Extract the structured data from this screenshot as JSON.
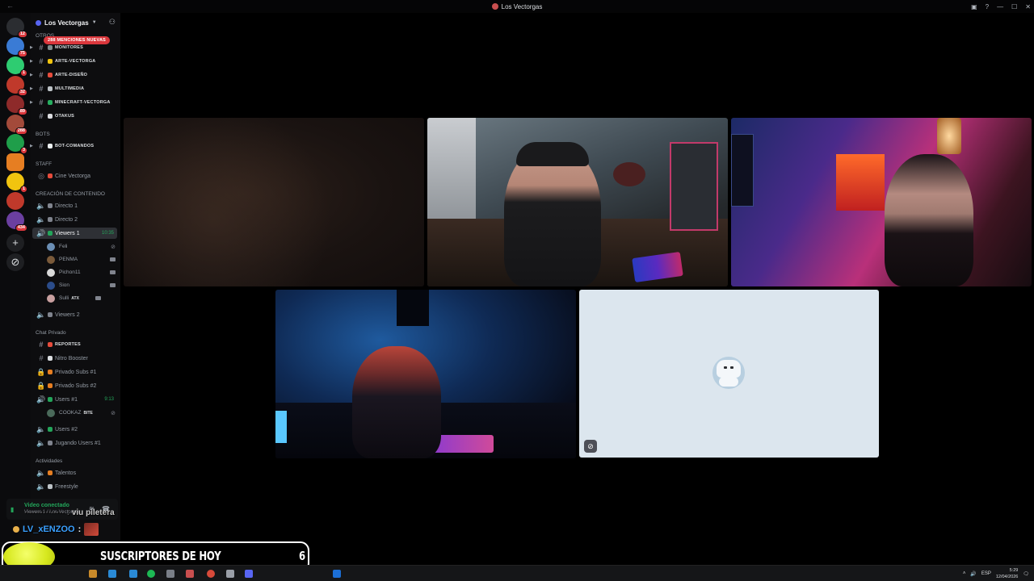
{
  "window": {
    "title": "Los Vectorgas",
    "controls": [
      "inbox-icon",
      "help-icon",
      "minimize-icon",
      "maximize-icon",
      "close-icon"
    ]
  },
  "rail": {
    "servers": [
      {
        "name": "direct-messages",
        "badge": "12",
        "color": "#2b2d31"
      },
      {
        "name": "server-1",
        "badge": "75",
        "color": "#3a7bd5"
      },
      {
        "name": "server-2",
        "badge": "1",
        "color": "#2ecc71"
      },
      {
        "name": "server-3",
        "badge": "32",
        "color": "#c0392b"
      },
      {
        "name": "server-4",
        "badge": "89",
        "color": "#8e2a2a"
      },
      {
        "name": "los-vectorgas",
        "badge": "288",
        "color": "#a34a3a"
      },
      {
        "name": "server-6",
        "badge": "3",
        "color": "#1f9e4a"
      },
      {
        "name": "server-7",
        "badge": "",
        "color": "#e67e22"
      },
      {
        "name": "server-8",
        "badge": "1",
        "color": "#f1c40f"
      },
      {
        "name": "server-9",
        "badge": "",
        "color": "#c0392b"
      },
      {
        "name": "server-10",
        "badge": "434",
        "color": "#6b3fa0"
      }
    ]
  },
  "sidebar": {
    "server_name": "Los Vectorgas",
    "mentions_pill": "288 MENCIONES NUEVAS",
    "categories": {
      "otros": "OTROS",
      "bots": "BOTS",
      "staff": "STAFF",
      "creacion": "CREACIÓN DE CONTENIDO",
      "chat_privado": "Chat Privado",
      "actividades": "Actividades"
    },
    "channels": {
      "monitores": "MONITORES",
      "arte_vectorga": "ARTE-VECTORGA",
      "arte_diseno": "ARTE-DISEÑO",
      "multimedia": "MULTIMEDIA",
      "minecraft": "MINECRAFT-VECTORGA",
      "otakus": "OTAKUS",
      "bot_comandos": "BOT-COMANDOS",
      "cine": "Cine Vectorga",
      "directo1": "Directo 1",
      "directo2": "Directo 2",
      "viewers1": "Viewers 1",
      "viewers1_timer": "10:35",
      "viewers2": "Viewers 2",
      "reportes": "REPORTES",
      "nitro": "Nitro Booster",
      "privado1": "Privado Subs #1",
      "privado2": "Privado Subs #2",
      "users1": "Users #1",
      "users1_timer": "9:13",
      "users2": "Users #2",
      "jugando": "Jugando Users #1",
      "talentos": "Talentos",
      "freestyle": "Freestyle"
    },
    "viewers1_members": [
      {
        "name": "Feli",
        "avatar": "#6b8fb5"
      },
      {
        "name": "PENMA",
        "avatar": "#7a5a3a"
      },
      {
        "name": "Pichon11",
        "avatar": "#d9d9d9"
      },
      {
        "name": "Sion",
        "avatar": "#2b4c8a"
      },
      {
        "name": "Sulli",
        "avatar": "#c9a0a0",
        "tag": "ATX"
      }
    ],
    "users1_members": [
      {
        "name": "COOKAZ",
        "avatar": "#4a6a5a",
        "tag": "BITE"
      }
    ]
  },
  "voice": {
    "status": "Video conectado",
    "channel": "Viewers 1 / Los Vectorgas"
  },
  "chat_overlay": {
    "line1": "viu piletera",
    "user": "LV_xENZOO",
    "colon": ":"
  },
  "subs_overlay": {
    "label": "SUSCRIPTORES DE HOY",
    "count": "6"
  },
  "taskbar": {
    "lang": "ESP",
    "time": "5:29",
    "date": "12/04/2026"
  }
}
